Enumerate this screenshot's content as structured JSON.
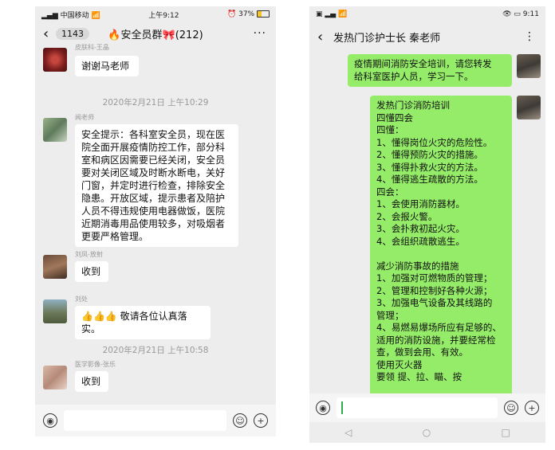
{
  "left": {
    "status": {
      "carrier": "中国移动",
      "time": "上午9:12",
      "battery": "37%"
    },
    "header": {
      "back_badge": "1143",
      "title": "安全员群",
      "count": "(212)"
    },
    "messages": [
      {
        "nick": "皮肤科-王晶",
        "text": "谢谢马老师"
      },
      {
        "time": "2020年2月21日 上午10:29"
      },
      {
        "nick": "闻老师",
        "lines": [
          "安全提示：各科室安全员，现在医",
          "院全面开展疫情防控工作，部分科",
          "室和病区因需要已经关闭，安全员",
          "要对关闭区域及时断水断电，关好",
          "门窗，并定时进行检查，排除安全",
          "隐患。开放区域，提示患者及陪护",
          "人员不得违规使用电器做饭，医院",
          "近期消毒用品使用较多，对吸烟者",
          "更要严格管理。"
        ]
      },
      {
        "nick": "刘凤-放射",
        "text": "收到"
      },
      {
        "nick": "刘处",
        "emoji": "👍👍👍",
        "text": "敬请各位认真落实。"
      },
      {
        "time": "2020年2月21日 上午10:58"
      },
      {
        "nick": "医学影像-张乐",
        "text": "收到"
      }
    ]
  },
  "right": {
    "status": {
      "time": "9:11"
    },
    "header": {
      "title": "发热门诊护士长  秦老师"
    },
    "msg1": [
      "疫情期间消防安全培训，请您转发",
      "给科室医护人员，学习一下。"
    ],
    "msg2": [
      "发热门诊消防培训",
      "四懂四会",
      "四懂：",
      "1、懂得岗位火灾的危险性。",
      "2、懂得预防火灾的措施。",
      "3、懂得扑救火灾的方法。",
      "4、懂得逃生疏散的方法。",
      "四会：",
      "1、会使用消防器材。",
      "2、会报火警。",
      "3、会扑救初起火灾。",
      "4、会组织疏散逃生。",
      "",
      "减少消防事故的措施",
      "1、加强对可燃物质的管理；",
      "2、管理和控制好各种火源；",
      "3、加强电气设备及其线路的",
      "管理；",
      "4、易燃易爆场所应有足够的、",
      "适用的消防设施，并要经常检",
      "查，做到会用、有效。",
      "使用灭火器",
      "要领 提、拉、瞄、按"
    ]
  }
}
